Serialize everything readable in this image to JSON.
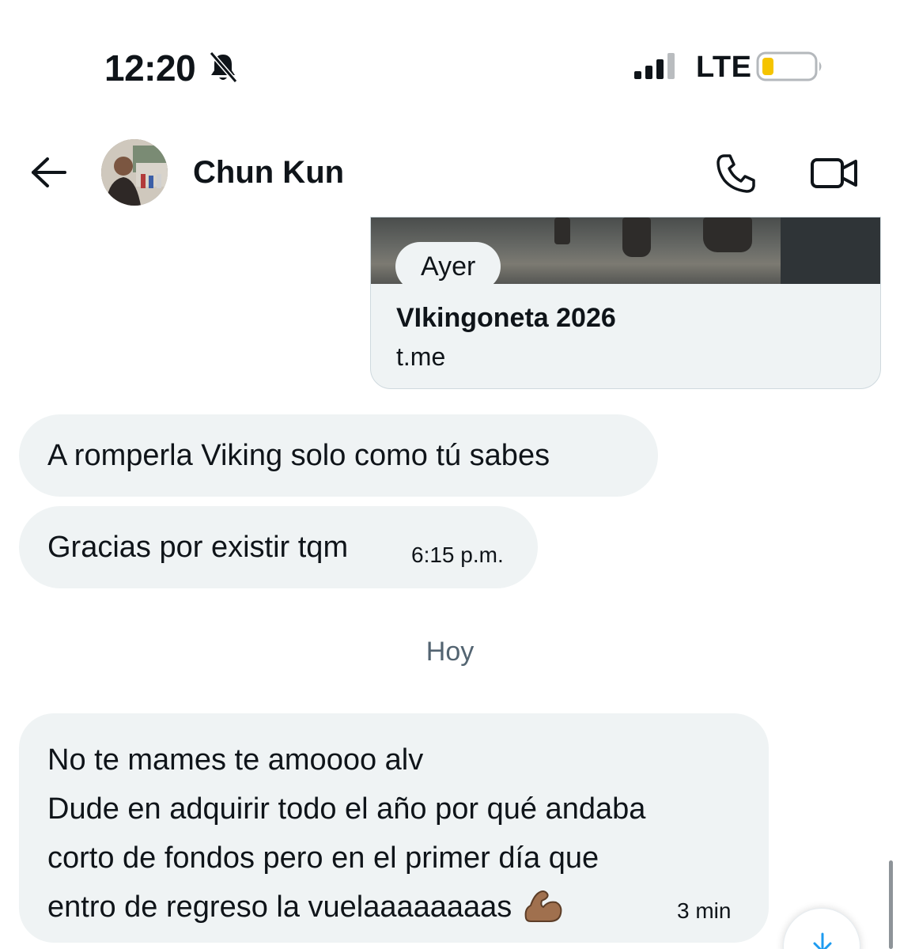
{
  "status_bar": {
    "time": "12:20",
    "network": "LTE",
    "battery_color": "#f5c400"
  },
  "header": {
    "contact_name": "Chun Kun"
  },
  "link_preview": {
    "title": "VIkingoneta 2026",
    "domain": "t.me"
  },
  "separators": {
    "yesterday": "Ayer",
    "today": "Hoy"
  },
  "messages": [
    {
      "text": "A romperla Viking solo como tú sabes"
    },
    {
      "text": "Gracias por existir tqm",
      "time": "6:15 p.m."
    },
    {
      "lines": [
        "No te mames te amoooo alv",
        "Dude en adquirir todo el año por qué andaba",
        "corto de fondos pero en el primer día que",
        "entro de regreso la vuelaaaaaaaas"
      ],
      "emoji": "muscle-icon",
      "time": "3 min"
    }
  ],
  "colors": {
    "bubble": "#eff3f4",
    "text": "#0f1419",
    "muted": "#536471",
    "accent": "#1d9bf0"
  }
}
